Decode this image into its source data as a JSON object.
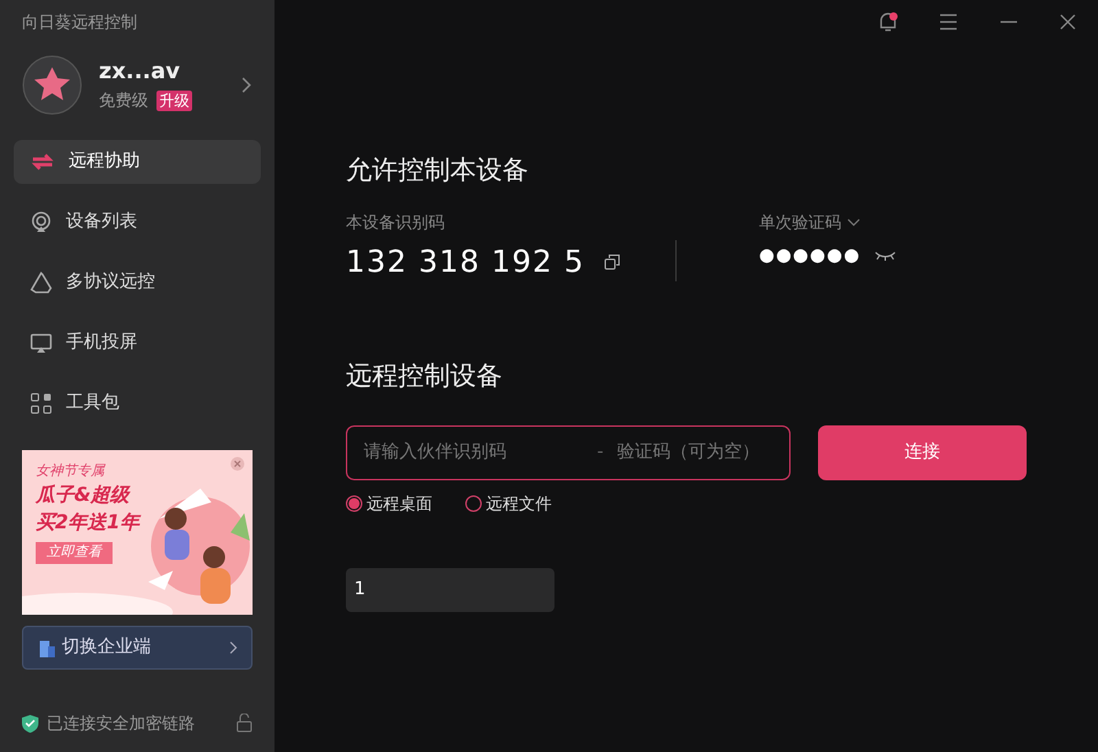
{
  "app_title": "向日葵远程控制",
  "account": {
    "name": "zx...av",
    "plan": "免费级",
    "upgrade": "升级"
  },
  "nav": [
    {
      "label": "远程协助",
      "selected": true
    },
    {
      "label": "设备列表",
      "selected": false
    },
    {
      "label": "多协议远控",
      "selected": false
    },
    {
      "label": "手机投屏",
      "selected": false
    },
    {
      "label": "工具包",
      "selected": false
    }
  ],
  "banner": {
    "tag": "女神节专属",
    "headline": "瓜子&超级",
    "offer": "买2年送1年",
    "cta": "立即查看"
  },
  "enterprise_button": "切换企业端",
  "security_status": "已连接安全加密链路",
  "allow_section": {
    "title": "允许控制本设备",
    "id_label": "本设备识别码",
    "device_id": "132 318 192 5",
    "code_label": "单次验证码",
    "code": "●●●●●●"
  },
  "remote_section": {
    "title": "远程控制设备",
    "id_placeholder": "请输入伙伴识别码",
    "separator": "-",
    "code_placeholder": "验证码（可为空）",
    "connect": "连接",
    "modes": [
      {
        "label": "远程桌面",
        "selected": true
      },
      {
        "label": "远程文件",
        "selected": false
      }
    ],
    "history": [
      "1"
    ]
  }
}
